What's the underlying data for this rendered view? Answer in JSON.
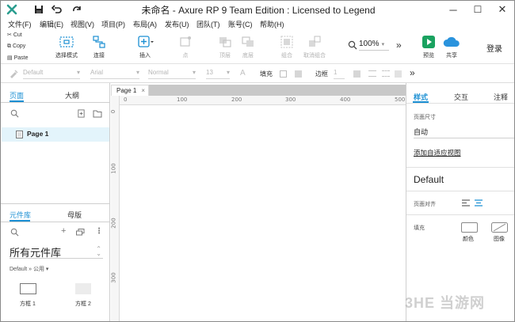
{
  "titlebar": {
    "title": "未命名 - Axure RP 9 Team Edition : Licensed to Legend",
    "minimize": "─",
    "maximize": "☐",
    "close": "✕"
  },
  "menu": [
    "文件(F)",
    "编辑(E)",
    "视图(V)",
    "项目(P)",
    "布局(A)",
    "发布(U)",
    "团队(T)",
    "账号(C)",
    "帮助(H)"
  ],
  "clipboard": {
    "cut": "Cut",
    "copy": "Copy",
    "paste": "Paste"
  },
  "toolbar": {
    "select_mode": "选择模式",
    "connect": "连接",
    "insert": "插入",
    "point": "点",
    "top": "顶层",
    "bottom": "底层",
    "group": "组合",
    "ungroup": "取消组合",
    "zoom": "100%",
    "preview": "预览",
    "share": "共享",
    "login": "登录"
  },
  "formatbar": {
    "style": "Default",
    "font": "Arial",
    "weight": "Normal",
    "size": "13",
    "fill_label": "填充",
    "border_label": "边框",
    "border_value": "1"
  },
  "leftpanel": {
    "tabs": [
      "页面",
      "大纲"
    ],
    "pages": [
      "Page 1"
    ],
    "lib_tabs": [
      "元件库",
      "母版"
    ],
    "library_name": "所有元件库",
    "library_filter": "Default » 公用 ▾",
    "widgets": [
      "方框 1",
      "方框 2"
    ]
  },
  "canvas": {
    "page_tab": "Page 1",
    "ruler_h": [
      "0",
      "100",
      "200",
      "300",
      "400",
      "500"
    ],
    "ruler_v": [
      "0",
      "100",
      "200",
      "300"
    ]
  },
  "rightpanel": {
    "tabs": [
      "样式",
      "交互",
      "注释"
    ],
    "page_size_label": "页面尺寸",
    "page_size_value": "自动",
    "adaptive_link": "添加自适应视图",
    "style_name": "Default",
    "align_label": "页面对齐",
    "fill_label": "填充",
    "fill_color": "颜色",
    "fill_image": "图像"
  },
  "watermark": "3HE 当游网",
  "colors": {
    "accent": "#1b8fd3",
    "preview_green": "#1aa260",
    "share_blue": "#2a93dd"
  }
}
